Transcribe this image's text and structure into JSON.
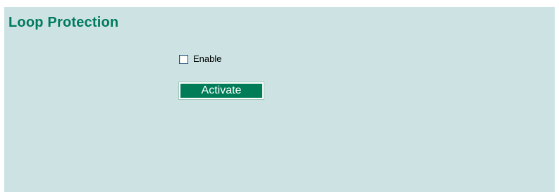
{
  "page": {
    "title": "Loop Protection"
  },
  "form": {
    "enable": {
      "label": "Enable",
      "checked": false
    },
    "activate_label": "Activate"
  },
  "colors": {
    "panel_background": "#cde3e3",
    "title_text": "#007a5e",
    "button_background": "#007d57",
    "button_text": "#ffffff"
  }
}
